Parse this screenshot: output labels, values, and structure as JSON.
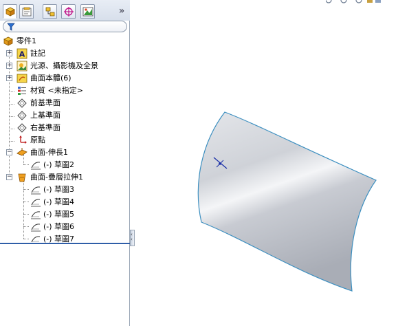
{
  "feature_manager": {
    "tabs": [
      {
        "name": "featuremanager-tab",
        "icon": "feature-tree-icon",
        "active": true
      },
      {
        "name": "propertymanager-tab",
        "icon": "property-manager-icon",
        "active": false
      },
      {
        "name": "configurationmanager-tab",
        "icon": "configuration-icon",
        "active": false
      },
      {
        "name": "dimxpert-tab",
        "icon": "dimxpert-crosshair-icon",
        "active": false
      },
      {
        "name": "display-manager-tab",
        "icon": "display-manager-icon",
        "active": false
      }
    ],
    "expand_label": "»",
    "filter_icon": "filter-funnel-icon",
    "tree": {
      "part": "零件1",
      "annotations": "註記",
      "lights": "光源、攝影機及全景",
      "surface_bodies": "曲面本體(6)",
      "material": "材質 <未指定>",
      "front_plane": "前基準面",
      "top_plane": "上基準面",
      "right_plane": "右基準面",
      "origin": "原點",
      "extend": "曲面-伸長1",
      "extend_sketch": "(-) 草圖2",
      "loft": "曲面-疊層拉伸1",
      "loft_sketches": [
        "(-) 草圖3",
        "(-) 草圖4",
        "(-) 草圖5",
        "(-) 草圖6",
        "(-) 草圖7"
      ]
    },
    "colors": {
      "accent": "#2f5ea8",
      "tab_strip": "#d7dfeb"
    }
  },
  "graphics_area": {
    "surface_color": "#d8dadf",
    "edge_color": "#3c8fc0",
    "sketch_point_color": "#1a2fa8"
  }
}
